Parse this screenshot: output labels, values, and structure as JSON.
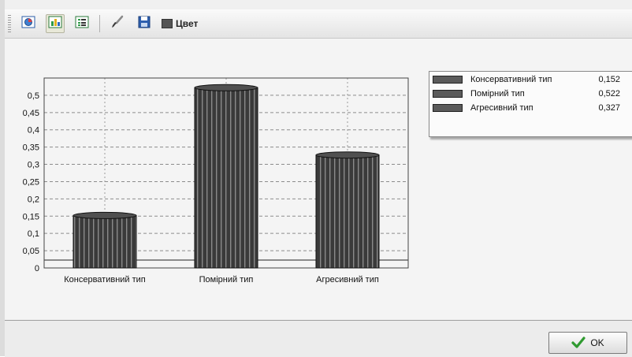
{
  "toolbar": {
    "buttons": [
      {
        "icon": "chart-type-icon"
      },
      {
        "icon": "bar-chart-icon",
        "pressed": true
      },
      {
        "icon": "legend-list-icon"
      },
      {
        "icon": "brush-icon"
      },
      {
        "icon": "save-icon"
      }
    ],
    "color_label": "Цвет"
  },
  "chart_data": {
    "type": "bar",
    "categories": [
      "Консервативний тип",
      "Помірний тип",
      "Агресивний тип"
    ],
    "values": [
      0.152,
      0.522,
      0.327
    ],
    "title": "",
    "xlabel": "",
    "ylabel": "",
    "ylim": [
      0,
      0.55
    ],
    "yticks": [
      "0",
      "0,05",
      "0,1",
      "0,15",
      "0,2",
      "0,25",
      "0,3",
      "0,35",
      "0,4",
      "0,45",
      "0,5"
    ],
    "grid": true,
    "bar_color": "#3a3a3a",
    "legend_position": "top-right"
  },
  "legend": {
    "items": [
      {
        "name": "Консервативний тип",
        "value": "0,152"
      },
      {
        "name": "Помірний тип",
        "value": "0,522"
      },
      {
        "name": "Агресивний тип",
        "value": "0,327"
      }
    ]
  },
  "footer": {
    "ok_label": "OK"
  }
}
